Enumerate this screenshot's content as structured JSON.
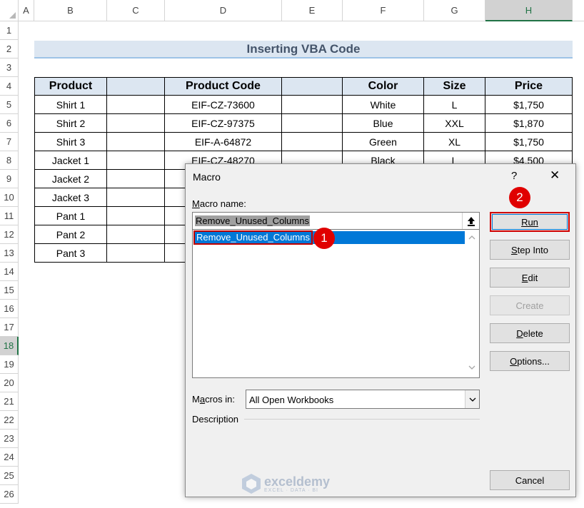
{
  "columns": [
    "A",
    "B",
    "C",
    "D",
    "E",
    "F",
    "G",
    "H"
  ],
  "rows": [
    "1",
    "2",
    "3",
    "4",
    "5",
    "6",
    "7",
    "8",
    "9",
    "10",
    "11",
    "12",
    "13",
    "14",
    "15",
    "16",
    "17",
    "18",
    "19",
    "20",
    "21",
    "22",
    "23",
    "24",
    "25",
    "26"
  ],
  "title": "Inserting VBA Code",
  "table": {
    "headers": [
      "Product",
      "",
      "Product Code",
      "",
      "Color",
      "Size",
      "Price"
    ],
    "rows": [
      [
        "Shirt 1",
        "",
        "EIF-CZ-73600",
        "",
        "White",
        "L",
        "$1,750"
      ],
      [
        "Shirt 2",
        "",
        "EIF-CZ-97375",
        "",
        "Blue",
        "XXL",
        "$1,870"
      ],
      [
        "Shirt 3",
        "",
        "EIF-A-64872",
        "",
        "Green",
        "XL",
        "$1,750"
      ],
      [
        "Jacket 1",
        "",
        "EIF-CZ-48270",
        "",
        "Black",
        "L",
        "$4,500"
      ],
      [
        "Jacket 2",
        "",
        "",
        "",
        "",
        "",
        ""
      ],
      [
        "Jacket 3",
        "",
        "",
        "",
        "",
        "",
        ""
      ],
      [
        "Pant 1",
        "",
        "",
        "",
        "",
        "",
        ""
      ],
      [
        "Pant 2",
        "",
        "",
        "",
        "",
        "",
        ""
      ],
      [
        "Pant 3",
        "",
        "",
        "",
        "",
        "",
        ""
      ]
    ]
  },
  "dialog": {
    "title": "Macro",
    "help": "?",
    "close": "✕",
    "macro_name_label": "Macro name:",
    "macro_name_value": "Remove_Unused_Columns",
    "list_items": [
      "Remove_Unused_Columns"
    ],
    "macros_in_label": "Macros in:",
    "macros_in_value": "All Open Workbooks",
    "description_label": "Description",
    "buttons": {
      "run": "Run",
      "step_into": "Step Into",
      "edit": "Edit",
      "create": "Create",
      "delete": "Delete",
      "options": "Options...",
      "cancel": "Cancel"
    },
    "badge1": "1",
    "badge2": "2"
  },
  "watermark": {
    "name": "exceldemy",
    "tagline": "EXCEL · DATA · BI"
  },
  "colors": {
    "accent_green": "#217346",
    "header_fill": "#dce6f1",
    "selection": "#0078d7",
    "badge_red": "#e00000"
  }
}
